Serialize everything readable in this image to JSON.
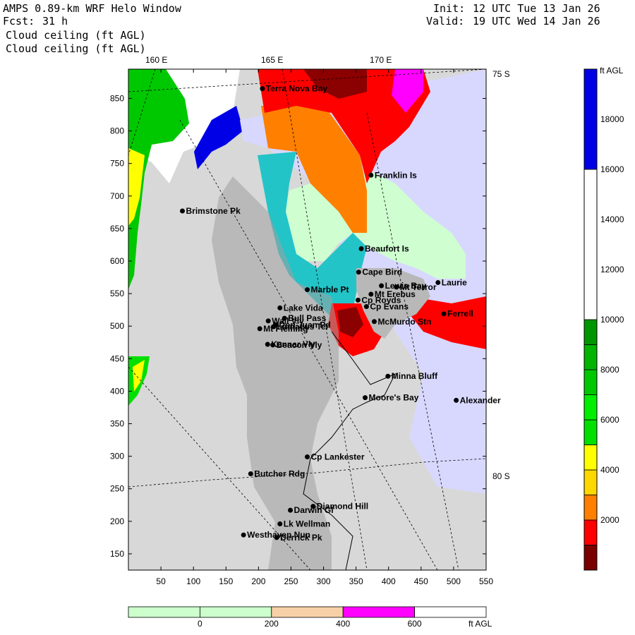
{
  "header": {
    "model_title": "AMPS 0.89-km WRF Helo Window",
    "forecast_label": "Fcst:",
    "forecast_value": "31 h",
    "field_line_1": "Cloud ceiling (ft AGL)",
    "field_line_2": "Cloud ceiling (ft AGL)",
    "init_label": "Init:",
    "init_value": "12 UTC Tue 13 Jan 26",
    "valid_label": "Valid:",
    "valid_value": "19 UTC Wed 14 Jan 26"
  },
  "map": {
    "longitude_labels": [
      "160 E",
      "165 E",
      "170 E"
    ],
    "latitude_labels": [
      "75 S",
      "80 S"
    ],
    "x_ticks": [
      "50",
      "100",
      "150",
      "200",
      "250",
      "300",
      "350",
      "400",
      "450",
      "500",
      "550"
    ],
    "y_ticks": [
      "850",
      "800",
      "750",
      "700",
      "650",
      "600",
      "550",
      "500",
      "450",
      "400",
      "350",
      "300",
      "250",
      "200",
      "150"
    ],
    "places": [
      {
        "name": "Terra Nova Bay",
        "x": 206,
        "y": 865
      },
      {
        "name": "Franklin Is",
        "x": 373,
        "y": 732
      },
      {
        "name": "Brimstone Pk",
        "x": 83,
        "y": 677
      },
      {
        "name": "Beaufort Is",
        "x": 358,
        "y": 619
      },
      {
        "name": "Cape Bird",
        "x": 354,
        "y": 583
      },
      {
        "name": "Lewis Bay",
        "x": 389,
        "y": 562
      },
      {
        "name": "Laurie",
        "x": 476,
        "y": 567
      },
      {
        "name": "Mt Terror",
        "x": 412,
        "y": 560
      },
      {
        "name": "Marble Pt",
        "x": 275,
        "y": 556
      },
      {
        "name": "Cp Royds",
        "x": 353,
        "y": 540
      },
      {
        "name": "Mt Erebus",
        "x": 373,
        "y": 549
      },
      {
        "name": "Lake Vida",
        "x": 233,
        "y": 528
      },
      {
        "name": "Cp Evans",
        "x": 366,
        "y": 530
      },
      {
        "name": "Ferrell",
        "x": 485,
        "y": 519
      },
      {
        "name": "Wall Vly",
        "x": 215,
        "y": 508
      },
      {
        "name": "Bull Pass",
        "x": 240,
        "y": 512
      },
      {
        "name": "McMurdo Stn",
        "x": 378,
        "y": 507
      },
      {
        "name": "Don Juan Pd",
        "x": 226,
        "y": 502
      },
      {
        "name": "Mt Fleming",
        "x": 202,
        "y": 496
      },
      {
        "name": "Linnaeus Ter",
        "x": 223,
        "y": 499
      },
      {
        "name": "Kennar Vly",
        "x": 214,
        "y": 472
      },
      {
        "name": "Beacon Vly",
        "x": 222,
        "y": 471
      },
      {
        "name": "Minna Bluff",
        "x": 399,
        "y": 423
      },
      {
        "name": "Moore's Bay",
        "x": 364,
        "y": 390
      },
      {
        "name": "Alexander",
        "x": 504,
        "y": 386
      },
      {
        "name": "Cp Lankester",
        "x": 275,
        "y": 299
      },
      {
        "name": "Butcher Rdg",
        "x": 188,
        "y": 273
      },
      {
        "name": "Diamond Hill",
        "x": 284,
        "y": 223
      },
      {
        "name": "Darwin Gl",
        "x": 249,
        "y": 217
      },
      {
        "name": "Lk Wellman",
        "x": 233,
        "y": 196
      },
      {
        "name": "Westhaven Nun",
        "x": 177,
        "y": 179
      },
      {
        "name": "Derrick Pk",
        "x": 228,
        "y": 175
      }
    ]
  },
  "colorbar_right": {
    "unit": "ft AGL",
    "labels": [
      "18000",
      "16000",
      "14000",
      "12000",
      "10000",
      "8000",
      "6000",
      "4000",
      "2000"
    ],
    "bands": [
      {
        "from": 0,
        "to": 1000,
        "color": "#7a0000"
      },
      {
        "from": 1000,
        "to": 2000,
        "color": "#ff0000"
      },
      {
        "from": 2000,
        "to": 3000,
        "color": "#ff7f00"
      },
      {
        "from": 3000,
        "to": 4000,
        "color": "#ffd700"
      },
      {
        "from": 4000,
        "to": 5000,
        "color": "#ffff00"
      },
      {
        "from": 5000,
        "to": 6000,
        "color": "#00e000"
      },
      {
        "from": 6000,
        "to": 7000,
        "color": "#00ee00"
      },
      {
        "from": 7000,
        "to": 8000,
        "color": "#00c800"
      },
      {
        "from": 8000,
        "to": 9000,
        "color": "#00b400"
      },
      {
        "from": 9000,
        "to": 10000,
        "color": "#009600"
      },
      {
        "from": 10000,
        "to": 16000,
        "color": "#ffffff"
      },
      {
        "from": 16000,
        "to": 20000,
        "color": "#0000e6"
      }
    ]
  },
  "colorbar_bottom": {
    "unit": "ft AGL",
    "labels": [
      "0",
      "200",
      "400",
      "600"
    ],
    "bands": [
      {
        "color": "#ccffcc"
      },
      {
        "color": "#ccffcc"
      },
      {
        "color": "#f8d0a8"
      },
      {
        "color": "#ff00ff"
      },
      {
        "color": "#ffffff"
      }
    ]
  },
  "colors": {
    "terrain": "#d8d8d8",
    "ocean_white": "#ffffff",
    "cyan": "#22c4c8",
    "light_green": "#cfffd0",
    "lavender": "#d8d8ff",
    "red": "#ff0000",
    "dark_red": "#8b0000",
    "orange": "#ff7f00",
    "green": "#00c800",
    "blue": "#0000e6",
    "yellow": "#ffff00",
    "magenta": "#ff00ff"
  }
}
